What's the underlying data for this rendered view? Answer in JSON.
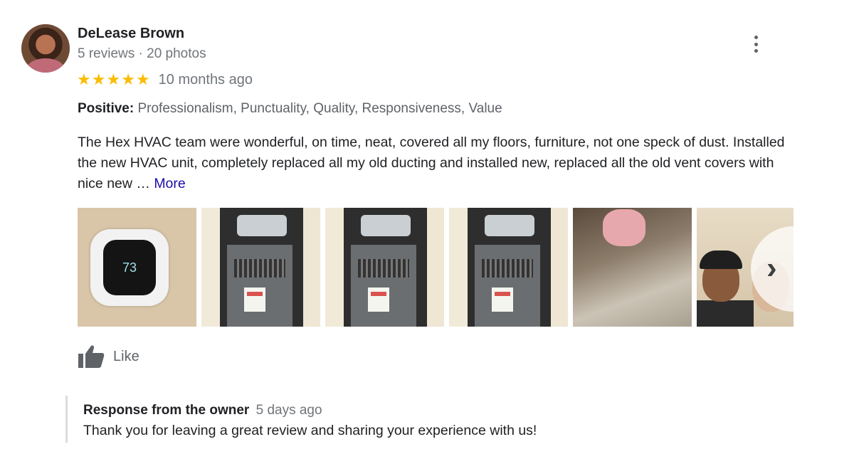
{
  "reviewer": {
    "name": "DeLease Brown",
    "stats": "5 reviews · 20 photos"
  },
  "rating": {
    "stars": 5,
    "out_of": 5,
    "time": "10 months ago",
    "star_color": "#fbbc04"
  },
  "positive": {
    "label": "Positive:",
    "items": "Professionalism, Punctuality, Quality, Responsiveness, Value"
  },
  "review": {
    "text": "The Hex HVAC team were wonderful, on time, neat, covered all my floors, furniture, not one speck of dust. Installed the new HVAC unit, completely replaced all my old ducting and installed new, replaced all the old vent covers with nice new … ",
    "more_label": "More"
  },
  "photos": {
    "thermostat_reading": "73",
    "items": [
      "thermostat",
      "furnace",
      "furnace",
      "furnace",
      "attic",
      "selfie"
    ]
  },
  "actions": {
    "like_label": "Like"
  },
  "owner_response": {
    "title": "Response from the owner",
    "date": "5 days ago",
    "text": "Thank you for leaving a great review and sharing your experience with us!"
  },
  "icons": {
    "menu": "more-vertical-icon",
    "like": "thumbs-up-icon",
    "next": "chevron-right-icon"
  },
  "colors": {
    "link": "#1a0dab",
    "muted": "#70757a"
  }
}
